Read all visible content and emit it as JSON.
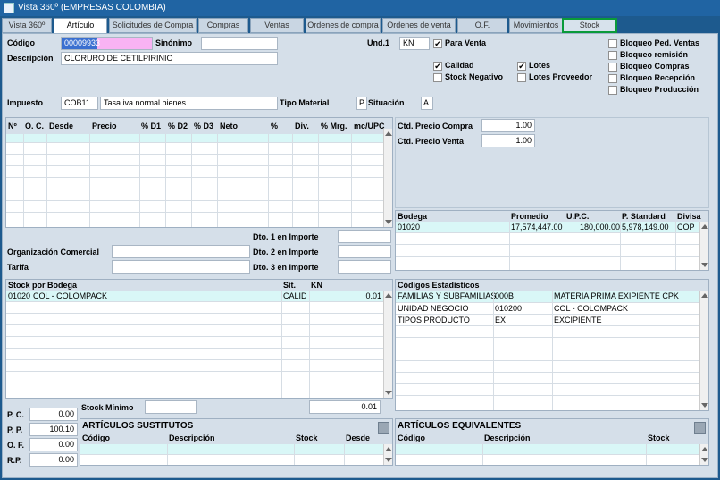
{
  "window": {
    "title": "Vista 360º (EMPRESAS COLOMBIA)"
  },
  "tabs": [
    "Vista 360º",
    "Artículo",
    "Solicitudes de Compra",
    "Compras",
    "Ventas",
    "Ordenes de compra",
    "Ordenes de venta",
    "O.F.",
    "Movimientos",
    "Stock"
  ],
  "article": {
    "codigo_label": "Código",
    "codigo": "00009933",
    "sinonimo_label": "Sinónimo",
    "sinonimo": "",
    "descripcion_label": "Descripción",
    "descripcion": "CLORURO DE CETILPIRINIO",
    "und_label": "Und.1",
    "und": "KN",
    "impuesto_label": "Impuesto",
    "impuesto_code": "COB11",
    "impuesto_desc": "Tasa iva normal bienes",
    "tipo_material_label": "Tipo Material",
    "tipo_material": "P",
    "situacion_label": "Situación",
    "situacion": "A"
  },
  "checks": {
    "para_venta": {
      "label": "Para Venta",
      "checked": "✔"
    },
    "calidad": {
      "label": "Calidad",
      "checked": "✔"
    },
    "stock_negativo": {
      "label": "Stock Negativo",
      "checked": ""
    },
    "lotes": {
      "label": "Lotes",
      "checked": "✔"
    },
    "lotes_proveedor": {
      "label": "Lotes Proveedor",
      "checked": ""
    },
    "bloqueo_ped_ventas": {
      "label": "Bloqueo Ped. Ventas",
      "checked": ""
    },
    "bloqueo_remision": {
      "label": "Bloqueo remisión",
      "checked": ""
    },
    "bloqueo_compras": {
      "label": "Bloqueo Compras",
      "checked": ""
    },
    "bloqueo_recepcion": {
      "label": "Bloqueo Recepción",
      "checked": ""
    },
    "bloqueo_produccion": {
      "label": "Bloqueo Producción",
      "checked": ""
    }
  },
  "prices_grid": {
    "headers": [
      "Nº",
      "O. C.",
      "Desde",
      "Precio",
      "% D1",
      "% D2",
      "% D3",
      "Neto",
      "%",
      "Div.",
      "% Mrg.",
      "mc/UPC"
    ]
  },
  "dtos": {
    "dto1_label": "Dto. 1 en Importe",
    "dto1": "",
    "dto2_label": "Dto. 2 en Importe",
    "dto2": "",
    "dto3_label": "Dto. 3 en Importe",
    "dto3": "",
    "org_label": "Organización Comercial",
    "org": "",
    "tarifa_label": "Tarifa",
    "tarifa": ""
  },
  "ctd": {
    "compra_label": "Ctd. Precio Compra",
    "compra": "1.00",
    "venta_label": "Ctd. Precio Venta",
    "venta": "1.00"
  },
  "bodega_grid": {
    "headers": [
      "Bodega",
      "Promedio",
      "U.P.C.",
      "P. Standard",
      "Divisa"
    ],
    "rows": [
      [
        "01020",
        "17,574,447.00",
        "180,000.00",
        "5,978,149.00",
        "COP"
      ]
    ]
  },
  "stock_grid": {
    "headers": [
      "Stock por Bodega",
      "Sit.",
      "KN"
    ],
    "rows": [
      [
        "01020",
        "COL - COLOMPACK",
        "CALID",
        "0.01"
      ]
    ],
    "stock_minimo_label": "Stock Mínimo",
    "stock_minimo": "",
    "total": "0.01"
  },
  "estadisticos": {
    "title": "Códigos Estadísticos",
    "rows": [
      [
        "FAMILIAS Y SUBFAMILIAS",
        "000B",
        "MATERIA PRIMA EXIPIENTE CPK"
      ],
      [
        "UNIDAD NEGOCIO",
        "010200",
        "COL - COLOMPACK"
      ],
      [
        "TIPOS PRODUCTO",
        "EX",
        "EXCIPIENTE"
      ]
    ]
  },
  "pp": {
    "pc_label": "P. C.",
    "pc": "0.00",
    "pp_label": "P. P.",
    "pp": "100.10",
    "of_label": "O. F.",
    "of": "0.00",
    "rp_label": "R.P.",
    "rp": "0.00"
  },
  "sustitutos": {
    "title": "ARTÍCULOS SUSTITUTOS",
    "headers": [
      "Código",
      "Descripción",
      "Stock",
      "Desde"
    ]
  },
  "equivalentes": {
    "title": "ARTÍCULOS EQUIVALENTES",
    "headers": [
      "Código",
      "Descripción",
      "Stock"
    ]
  }
}
